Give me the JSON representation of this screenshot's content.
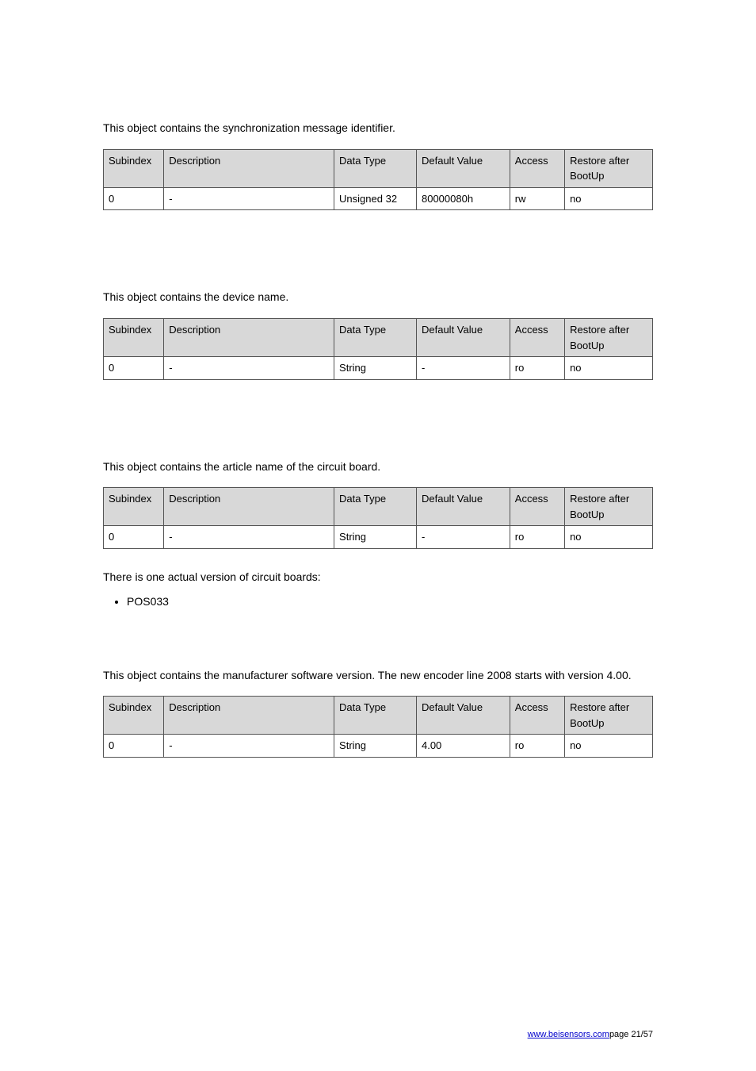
{
  "sections": [
    {
      "intro": "This object contains the synchronization message identifier.",
      "headers": {
        "subindex": "Subindex",
        "description": "Description",
        "data_type": "Data Type",
        "default_value": "Default Value",
        "access": "Access",
        "restore": "Restore after BootUp"
      },
      "row": {
        "subindex": "0",
        "description": "-",
        "data_type": "Unsigned 32",
        "default_value": "80000080h",
        "access": "rw",
        "restore": "no"
      }
    },
    {
      "intro": "This object contains the device name.",
      "headers": {
        "subindex": "Subindex",
        "description": "Description",
        "data_type": "Data Type",
        "default_value": "Default Value",
        "access": "Access",
        "restore": "Restore after BootUp"
      },
      "row": {
        "subindex": "0",
        "description": "-",
        "data_type": "String",
        "default_value": "-",
        "access": "ro",
        "restore": "no"
      }
    },
    {
      "intro": "This object contains the article name of the circuit board.",
      "headers": {
        "subindex": "Subindex",
        "description": "Description",
        "data_type": "Data Type",
        "default_value": "Default Value",
        "access": "Access",
        "restore": "Restore after BootUp"
      },
      "row": {
        "subindex": "0",
        "description": "-",
        "data_type": "String",
        "default_value": "-",
        "access": "ro",
        "restore": "no"
      }
    },
    {
      "intro": "This object contains the manufacturer software version. The new encoder line 2008 starts with version 4.00.",
      "headers": {
        "subindex": "Subindex",
        "description": "Description",
        "data_type": "Data Type",
        "default_value": "Default Value",
        "access": "Access",
        "restore": "Restore after BootUp"
      },
      "row": {
        "subindex": "0",
        "description": "-",
        "data_type": "String",
        "default_value": "4.00",
        "access": "ro",
        "restore": "no"
      }
    }
  ],
  "boards_intro": "There is one actual version of circuit boards:",
  "boards_item": "POS033",
  "footer": {
    "link": "www.beisensors.com",
    "page": "page 21/57"
  }
}
